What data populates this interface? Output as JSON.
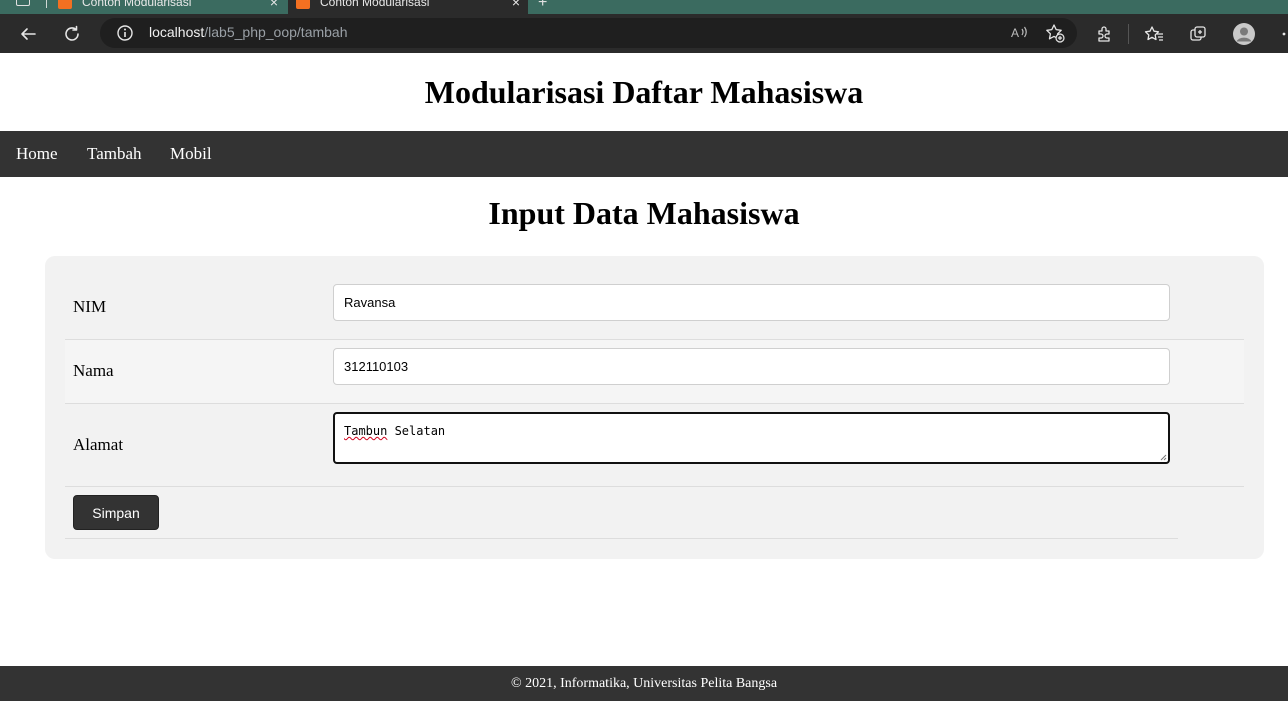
{
  "browser": {
    "tabs": [
      {
        "title": "Contoh Modularisasi"
      },
      {
        "title": "Contoh Modularisasi"
      }
    ],
    "url_host": "localhost",
    "url_path": "/lab5_php_oop/tambah",
    "icons": {
      "back": "back-arrow-icon",
      "reload": "reload-icon",
      "info": "info-icon",
      "read_aloud": "read-aloud-icon",
      "add_favorite": "add-favorite-icon",
      "extensions": "extensions-icon",
      "favorites": "favorites-icon",
      "collections": "collections-icon",
      "profile": "profile-avatar-icon",
      "more": "more-icon"
    }
  },
  "site": {
    "title": "Modularisasi Daftar Mahasiswa",
    "nav": [
      {
        "label": "Home"
      },
      {
        "label": "Tambah"
      },
      {
        "label": "Mobil"
      }
    ],
    "footer": "© 2021, Informatika, Universitas Pelita Bangsa"
  },
  "form": {
    "heading": "Input Data Mahasiswa",
    "fields": [
      {
        "label": "NIM",
        "value": "Ravansa"
      },
      {
        "label": "Nama",
        "value": "312110103"
      },
      {
        "label": "Alamat",
        "value_word1": "Tambun",
        "value_rest": " Selatan"
      }
    ],
    "submit_label": "Simpan"
  },
  "colors": {
    "nav_bg": "#333333",
    "card_bg": "#f2f2f2",
    "tab_strip": "#3b6b60",
    "toolbar": "#2b2b2b"
  }
}
